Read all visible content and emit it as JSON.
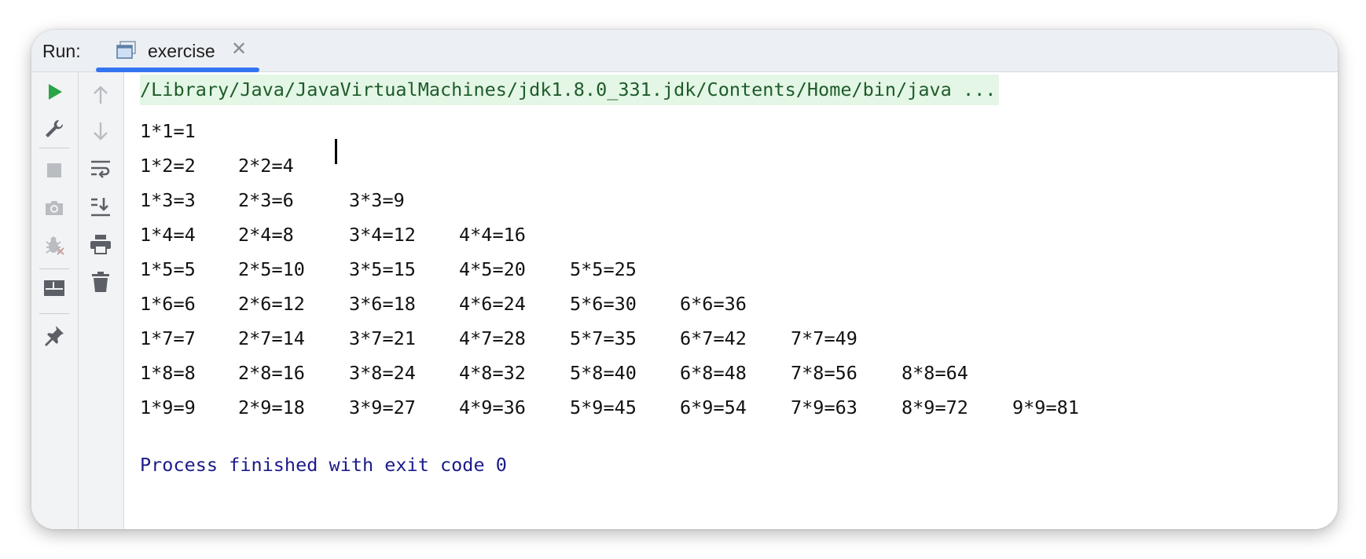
{
  "header": {
    "run_label": "Run:",
    "tab": {
      "label": "exercise",
      "close_glyph": "✕",
      "icon": "console-window-icon"
    }
  },
  "toolbar_primary": [
    {
      "name": "run-icon",
      "color": "#2aa545",
      "enabled": true
    },
    {
      "name": "wrench-icon",
      "enabled": true
    },
    {
      "name": "stop-icon",
      "enabled": false
    },
    {
      "name": "camera-icon",
      "enabled": false
    },
    {
      "name": "debug-bug-icon",
      "enabled": false
    },
    {
      "name": "layout-icon",
      "enabled": true
    },
    {
      "name": "pin-icon",
      "enabled": true
    }
  ],
  "toolbar_secondary": [
    {
      "name": "arrow-up-icon",
      "enabled": false
    },
    {
      "name": "arrow-down-icon",
      "enabled": false
    },
    {
      "name": "soft-wrap-icon",
      "enabled": true
    },
    {
      "name": "scroll-to-end-icon",
      "enabled": true
    },
    {
      "name": "print-icon",
      "enabled": true
    },
    {
      "name": "trash-icon",
      "enabled": true
    }
  ],
  "console": {
    "command": "/Library/Java/JavaVirtualMachines/jdk1.8.0_331.jdk/Contents/Home/bin/java ...",
    "rows": [
      [
        "1*1=1"
      ],
      [
        "1*2=2",
        "2*2=4"
      ],
      [
        "1*3=3",
        "2*3=6",
        "3*3=9"
      ],
      [
        "1*4=4",
        "2*4=8",
        "3*4=12",
        "4*4=16"
      ],
      [
        "1*5=5",
        "2*5=10",
        "3*5=15",
        "4*5=20",
        "5*5=25"
      ],
      [
        "1*6=6",
        "2*6=12",
        "3*6=18",
        "4*6=24",
        "5*6=30",
        "6*6=36"
      ],
      [
        "1*7=7",
        "2*7=14",
        "3*7=21",
        "4*7=28",
        "5*7=35",
        "6*7=42",
        "7*7=49"
      ],
      [
        "1*8=8",
        "2*8=16",
        "3*8=24",
        "4*8=32",
        "5*8=40",
        "6*8=48",
        "7*8=56",
        "8*8=64"
      ],
      [
        "1*9=9",
        "2*9=18",
        "3*9=27",
        "4*9=36",
        "5*9=45",
        "6*9=54",
        "7*9=63",
        "8*9=72",
        "9*9=81"
      ]
    ],
    "exit_message": "Process finished with exit code 0"
  },
  "colors": {
    "accent": "#3574f0",
    "command_bg": "#e4f6e5",
    "command_text": "#1e5b2b",
    "exit_text": "#1a1a8a",
    "run_green": "#2aa545"
  }
}
